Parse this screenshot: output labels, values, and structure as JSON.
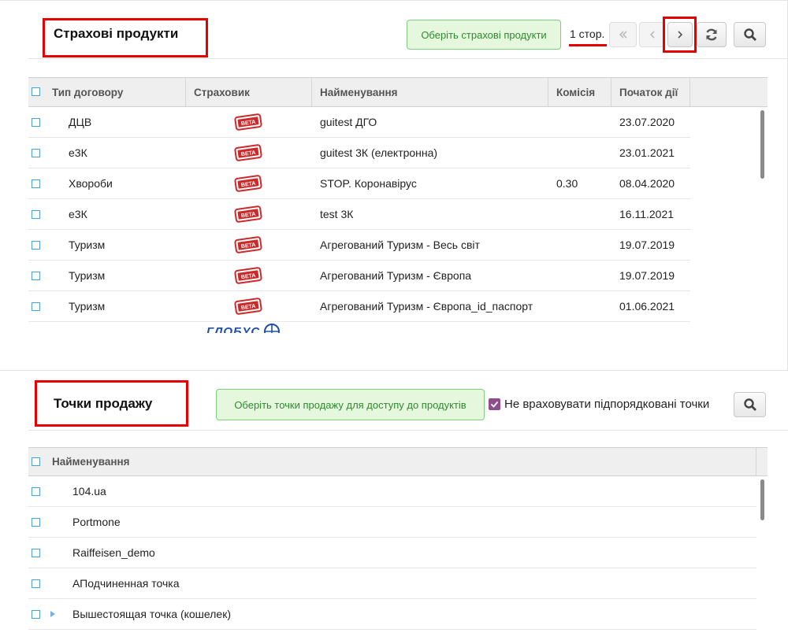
{
  "products": {
    "title": "Страхові продукти",
    "select_button": "Оберіть страхові продукти",
    "page_label": "1 стор.",
    "columns": [
      "Тип договору",
      "Страховик",
      "Найменування",
      "Комісія",
      "Початок дії"
    ],
    "rows": [
      {
        "type": "ДЦВ",
        "insurer_logo": "ВЕТА",
        "name": "guitest ДГО",
        "commission": "",
        "start": "23.07.2020"
      },
      {
        "type": "е3К",
        "insurer_logo": "ВЕТА",
        "name": "guitest 3К (електронна)",
        "commission": "",
        "start": "23.01.2021"
      },
      {
        "type": "Хвороби",
        "insurer_logo": "ВЕТА",
        "name": "STOP. Коронавірус",
        "commission": "0.30",
        "start": "08.04.2020"
      },
      {
        "type": "е3К",
        "insurer_logo": "ВЕТА",
        "name": "test 3К",
        "commission": "",
        "start": "16.11.2021"
      },
      {
        "type": "Туризм",
        "insurer_logo": "ВЕТА",
        "name": "Агрегований Туризм - Весь світ",
        "commission": "",
        "start": "19.07.2019"
      },
      {
        "type": "Туризм",
        "insurer_logo": "ВЕТА",
        "name": "Агрегований Туризм - Європа",
        "commission": "",
        "start": "19.07.2019"
      },
      {
        "type": "Туризм",
        "insurer_logo": "ВЕТА",
        "name": "Агрегований Туризм - Європа_id_паспорт",
        "commission": "",
        "start": "01.06.2021"
      }
    ],
    "partial_row_logo": "ГЛОБУС"
  },
  "points": {
    "title": "Точки продажу",
    "select_button": "Оберіть точки продажу для доступу до продуктів",
    "checkbox_label": "Не враховувати підпорядковані точки",
    "checkbox_checked": true,
    "columns": [
      "Найменування"
    ],
    "rows": [
      {
        "name": "104.ua",
        "expandable": false
      },
      {
        "name": "Portmone",
        "expandable": false
      },
      {
        "name": "Raiffeisen_demo",
        "expandable": false
      },
      {
        "name": "АПодчиненная точка",
        "expandable": false
      },
      {
        "name": "Вышестоящая точка (кошелек)",
        "expandable": true
      }
    ]
  },
  "icons": [
    "first-page-icon",
    "prev-page-icon",
    "next-page-icon",
    "refresh-icon",
    "search-icon",
    "checkmark-icon",
    "expand-arrow-icon"
  ],
  "colors": {
    "accent_red": "#e60000",
    "green_button_bg": "#e5f8de",
    "checkbox_purple": "#8e4e8e"
  }
}
